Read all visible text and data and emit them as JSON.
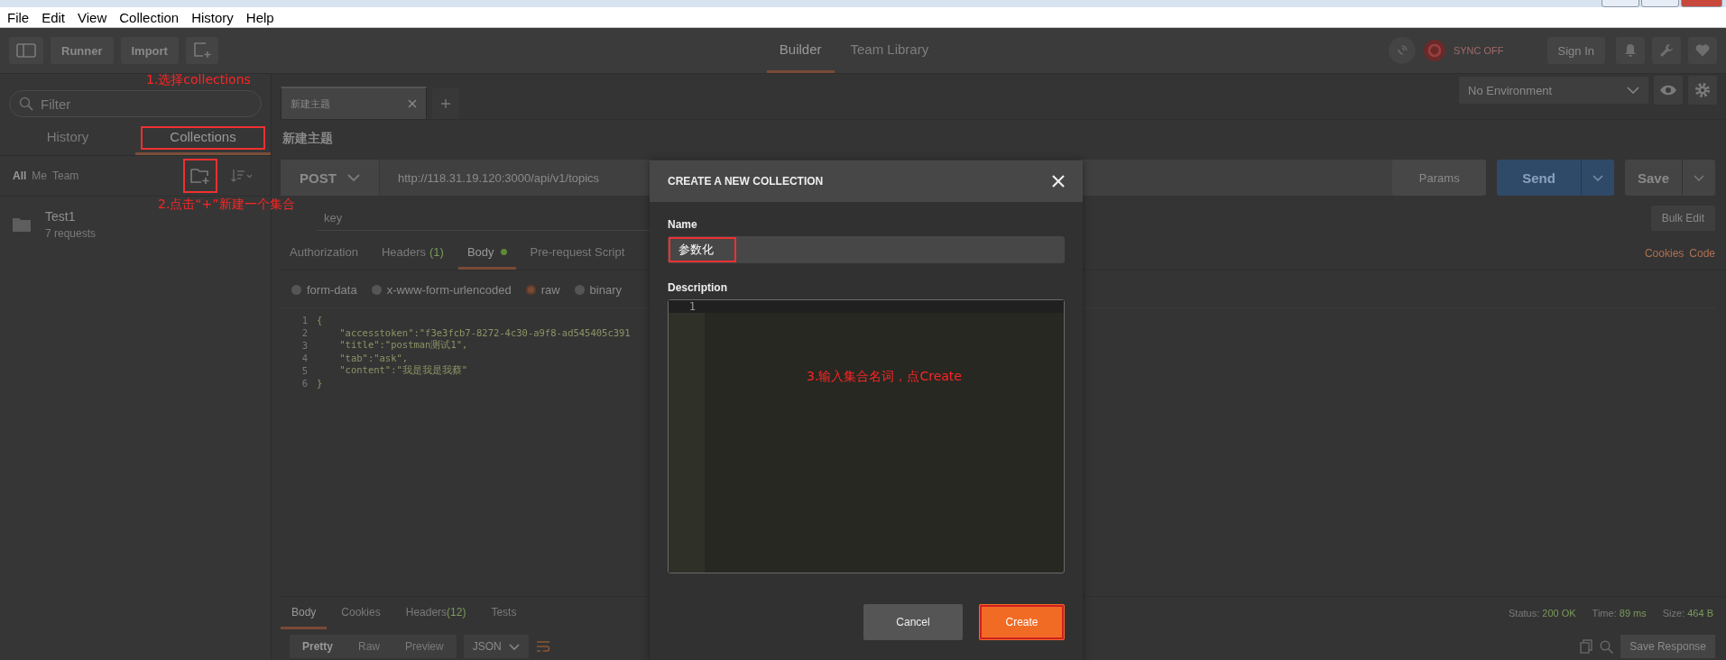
{
  "menu": [
    "File",
    "Edit",
    "View",
    "Collection",
    "History",
    "Help"
  ],
  "toolbar": {
    "buttons": [
      "Runner",
      "Import"
    ],
    "tabs": [
      {
        "label": "Builder",
        "selected": true
      },
      {
        "label": "Team Library",
        "selected": false
      }
    ],
    "sync": "SYNC OFF",
    "sign_in": "Sign In"
  },
  "sidebar": {
    "filter": {
      "placeholder": "Filter"
    },
    "tabs": [
      {
        "label": "History",
        "selected": false,
        "annotated": false
      },
      {
        "label": "Collections",
        "selected": true,
        "annotated": true
      }
    ],
    "scopes": [
      {
        "label": "All",
        "selected": true
      },
      {
        "label": "Me",
        "selected": false
      },
      {
        "label": "Team",
        "selected": false
      }
    ],
    "new_collection_annotated": true,
    "collections": [
      {
        "name": "Test1",
        "count": "7 requests"
      }
    ]
  },
  "annotations": [
    {
      "text": "1.选择collections"
    },
    {
      "text": "2.点击“+”新建一个集合"
    },
    {
      "text": "3.输入集合名词，点Create"
    }
  ],
  "request_tabs": [
    {
      "label": "新建主题",
      "selected": true
    }
  ],
  "environment": "No Environment",
  "request": {
    "title": "新建主题",
    "method": "POST",
    "url": "http://118.31.19.120:3000/api/v1/topics",
    "params": "Params",
    "send": "Send",
    "save": "Save",
    "key_placeholder": "key",
    "bulk_edit": "Bulk Edit",
    "tabs": [
      {
        "label": "Authorization",
        "dot": false,
        "selected": false
      },
      {
        "label": "Headers",
        "count": "(1)",
        "dot": false,
        "selected": false
      },
      {
        "label": "Body",
        "dot": true,
        "selected": true
      },
      {
        "label": "Pre-request Script",
        "dot": false,
        "selected": false
      }
    ],
    "links": [
      "Cookies",
      "Code"
    ],
    "body_modes": [
      {
        "label": "form-data",
        "selected": false
      },
      {
        "label": "x-www-form-urlencoded",
        "selected": false
      },
      {
        "label": "raw",
        "selected": true
      },
      {
        "label": "binary",
        "selected": false
      }
    ],
    "code": [
      {
        "number": "1",
        "text": "{"
      },
      {
        "number": "2",
        "text": "    \"accesstoken\":\"f3e3fcb7-8272-4c30-a9f8-ad545405c391"
      },
      {
        "number": "3",
        "text": "    \"title\":\"postman测试1\","
      },
      {
        "number": "4",
        "text": "    \"tab\":\"ask\","
      },
      {
        "number": "5",
        "text": "    \"content\":\"我是我是我蔡\""
      },
      {
        "number": "6",
        "text": "}"
      }
    ]
  },
  "response": {
    "tabs": [
      {
        "label": "Body",
        "selected": true
      },
      {
        "label": "Cookies",
        "selected": false
      },
      {
        "label": "Headers",
        "count": "(12)",
        "selected": false
      },
      {
        "label": "Tests",
        "selected": false
      }
    ],
    "status": [
      {
        "label": "Status:",
        "value": "200 OK"
      },
      {
        "label": "Time:",
        "value": "89 ms"
      },
      {
        "label": "Size:",
        "value": "464 B"
      }
    ],
    "views": [
      {
        "label": "Pretty",
        "selected": true
      },
      {
        "label": "Raw",
        "selected": false
      },
      {
        "label": "Preview",
        "selected": false
      }
    ],
    "format": "JSON",
    "save": "Save Response"
  },
  "modal": {
    "title": "CREATE A NEW COLLECTION",
    "name_label": "Name",
    "name_value": "参数化",
    "name_annotated": true,
    "description_label": "Description",
    "line_numbers": [
      "1"
    ],
    "cancel": "Cancel",
    "create": "Create",
    "create_annotated": true
  }
}
